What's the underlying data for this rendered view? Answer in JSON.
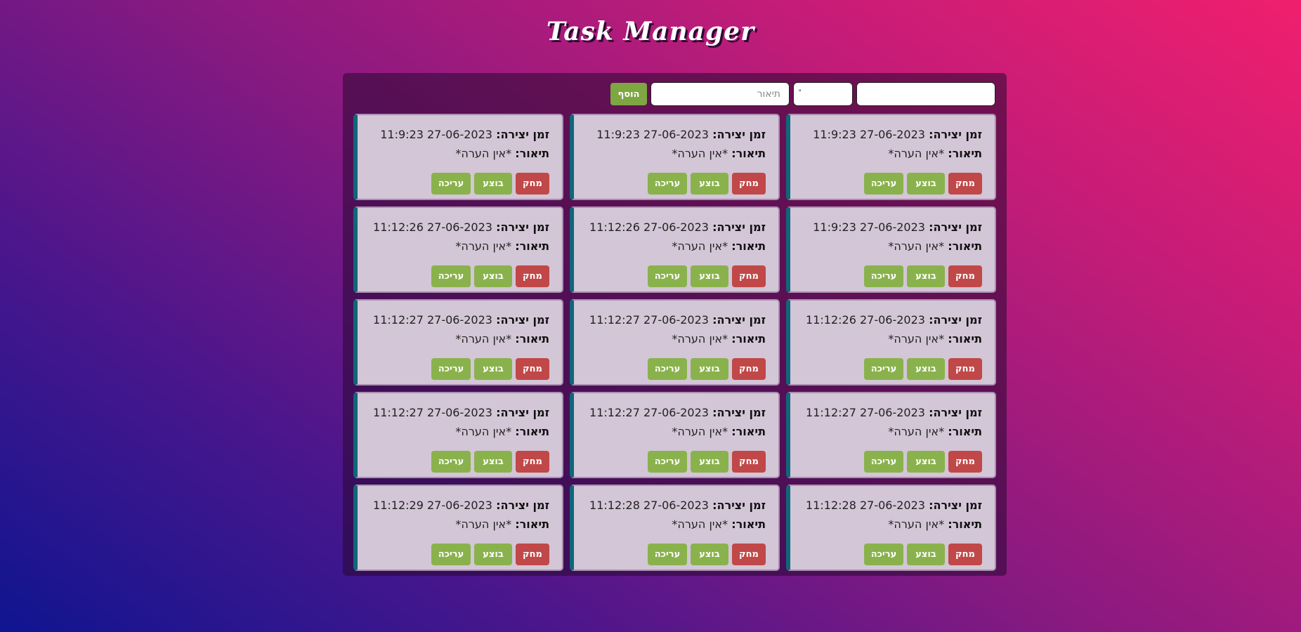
{
  "app": {
    "title": "Task Manager"
  },
  "form": {
    "name_value": "",
    "select_value": "",
    "description_placeholder": "תיאור",
    "add_label": "הוסף"
  },
  "labels": {
    "created": "זמן יצירה:",
    "description": "תיאור:",
    "delete": "מחק",
    "done": "בוצע",
    "edit": "עריכה"
  },
  "tasks": [
    {
      "created": "27-06-2023 11:9:23",
      "description": "*אין הערה*"
    },
    {
      "created": "27-06-2023 11:9:23",
      "description": "*אין הערה*"
    },
    {
      "created": "27-06-2023 11:9:23",
      "description": "*אין הערה*"
    },
    {
      "created": "27-06-2023 11:9:23",
      "description": "*אין הערה*"
    },
    {
      "created": "27-06-2023 11:12:26",
      "description": "*אין הערה*"
    },
    {
      "created": "27-06-2023 11:12:26",
      "description": "*אין הערה*"
    },
    {
      "created": "27-06-2023 11:12:26",
      "description": "*אין הערה*"
    },
    {
      "created": "27-06-2023 11:12:27",
      "description": "*אין הערה*"
    },
    {
      "created": "27-06-2023 11:12:27",
      "description": "*אין הערה*"
    },
    {
      "created": "27-06-2023 11:12:27",
      "description": "*אין הערה*"
    },
    {
      "created": "27-06-2023 11:12:27",
      "description": "*אין הערה*"
    },
    {
      "created": "27-06-2023 11:12:27",
      "description": "*אין הערה*"
    },
    {
      "created": "27-06-2023 11:12:28",
      "description": "*אין הערה*"
    },
    {
      "created": "27-06-2023 11:12:28",
      "description": "*אין הערה*"
    },
    {
      "created": "27-06-2023 11:12:29",
      "description": "*אין הערה*"
    }
  ],
  "colors": {
    "delete": "#c04848",
    "done": "#8ab24c",
    "edit": "#8ab24c",
    "card_accent": "#10667a",
    "card_bg": "#d3c6d6"
  }
}
